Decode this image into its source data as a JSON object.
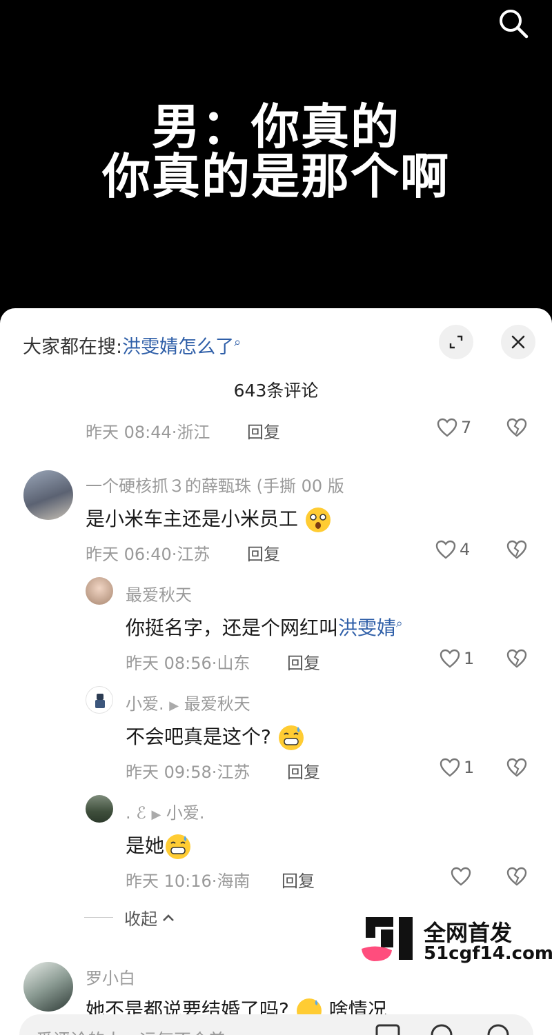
{
  "video": {
    "caption_line1": "男：你真的",
    "caption_line2": "你真的是那个啊",
    "search_icon": "search-icon"
  },
  "panel": {
    "hot_search_prefix": "大家都在搜:",
    "hot_search_keyword": "洪雯婧怎么了",
    "comment_count": "643条评论",
    "expand_icon": "expand-icon",
    "close_icon": "close-icon"
  },
  "comments": [
    {
      "id": "c0",
      "time": "昨天 08:44",
      "location": "浙江",
      "reply": "回复",
      "likes": "7"
    },
    {
      "id": "c1",
      "author": "一个硬核抓３的薛甄珠 (手撕 00 版",
      "text": "是小米车主还是小米员工",
      "time": "昨天 06:40",
      "location": "江苏",
      "reply": "回复",
      "likes": "4"
    },
    {
      "id": "r1",
      "author": "最爱秋天",
      "text_prefix": "你挺名字，还是个网红叫",
      "text_link": "洪雯婧",
      "time": "昨天 08:56",
      "location": "山东",
      "reply": "回复",
      "likes": "1"
    },
    {
      "id": "r2",
      "author": "小爱.",
      "reply_to": "最爱秋天",
      "text": "不会吧真是这个?",
      "time": "昨天 09:58",
      "location": "江苏",
      "reply": "回复",
      "likes": "1"
    },
    {
      "id": "r3",
      "author": ". ℰ",
      "reply_to": "小爱.",
      "text": "是她",
      "time": "昨天 10:16",
      "location": "海南",
      "reply": "回复",
      "likes": ""
    },
    {
      "id": "c2",
      "author": "罗小白",
      "text": "她不是都说要结婚了吗?",
      "text_suffix": "啥情况"
    }
  ],
  "collapse_label": "收起",
  "watermark": {
    "line1": "全网首发",
    "line2": "51cgf14.com"
  },
  "input_bar": {
    "placeholder": "爱评论的人，运气不会差"
  },
  "colors": {
    "link": "#2f5fa8",
    "meta": "#9a9a9a",
    "panel_bg": "#ffffff",
    "video_bg": "#000000"
  }
}
